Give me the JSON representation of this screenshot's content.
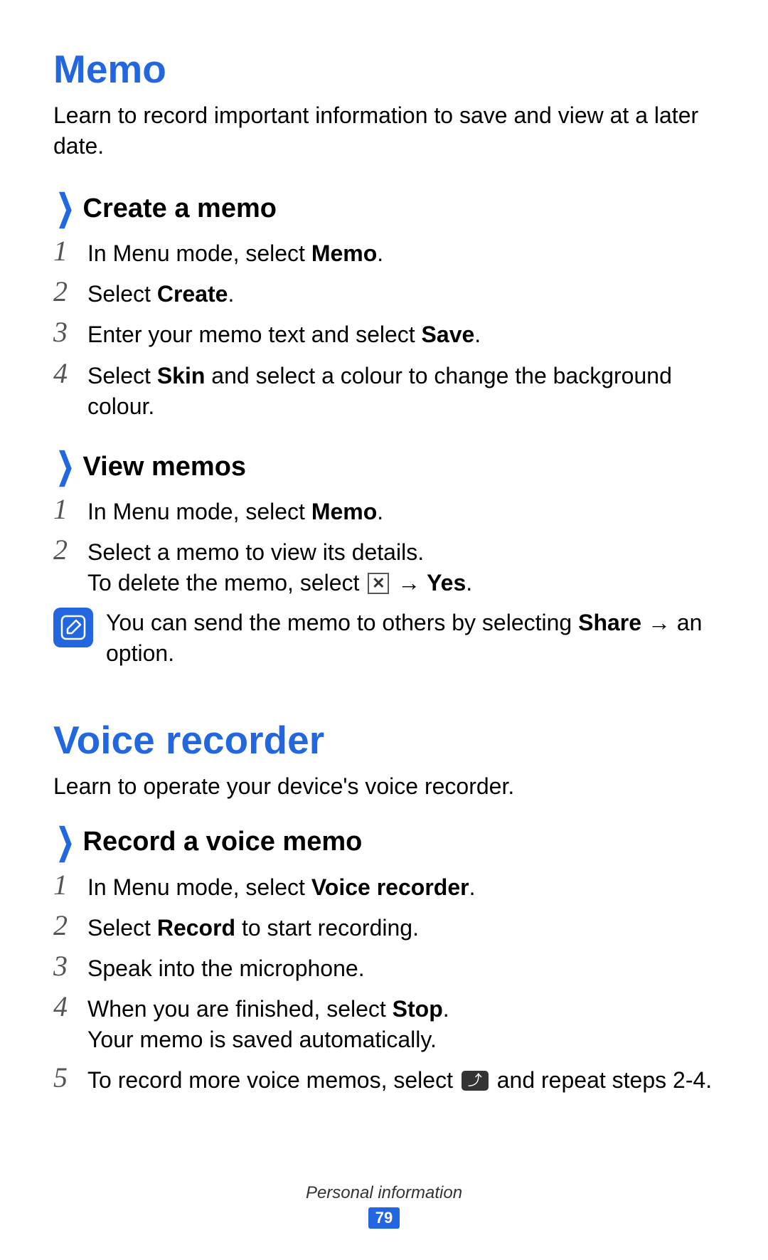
{
  "section1": {
    "title": "Memo",
    "intro": "Learn to record important information to save and view at a later date.",
    "sub1": {
      "title": "Create a memo",
      "steps": {
        "s1_pre": "In Menu mode, select ",
        "s1_bold": "Memo",
        "s1_post": ".",
        "s2_pre": "Select ",
        "s2_bold": "Create",
        "s2_post": ".",
        "s3_pre": "Enter your memo text and select ",
        "s3_bold": "Save",
        "s3_post": ".",
        "s4_pre": "Select ",
        "s4_bold": "Skin",
        "s4_post": " and select a colour to change the background colour."
      }
    },
    "sub2": {
      "title": "View memos",
      "steps": {
        "s1_pre": "In Menu mode, select ",
        "s1_bold": "Memo",
        "s1_post": ".",
        "s2_line1": "Select a memo to view its details.",
        "s2_line2_pre": "To delete the memo, select ",
        "s2_line2_arrow": " → ",
        "s2_line2_bold": "Yes",
        "s2_line2_post": "."
      },
      "note_pre": "You can send the memo to others by selecting ",
      "note_bold": "Share",
      "note_post": " → an option."
    }
  },
  "section2": {
    "title": "Voice recorder",
    "intro": "Learn to operate your device's voice recorder.",
    "sub1": {
      "title": "Record a voice memo",
      "steps": {
        "s1_pre": "In Menu mode, select ",
        "s1_bold": "Voice recorder",
        "s1_post": ".",
        "s2_pre": "Select ",
        "s2_bold": "Record",
        "s2_post": " to start recording.",
        "s3": "Speak into the microphone.",
        "s4_pre": "When you are finished, select ",
        "s4_bold": "Stop",
        "s4_post": ".",
        "s4_line2": "Your memo is saved automatically.",
        "s5_pre": "To record more voice memos, select ",
        "s5_post": " and repeat steps 2-4."
      }
    }
  },
  "nums": {
    "n1": "1",
    "n2": "2",
    "n3": "3",
    "n4": "4",
    "n5": "5"
  },
  "footer": {
    "section": "Personal information",
    "page": "79"
  }
}
